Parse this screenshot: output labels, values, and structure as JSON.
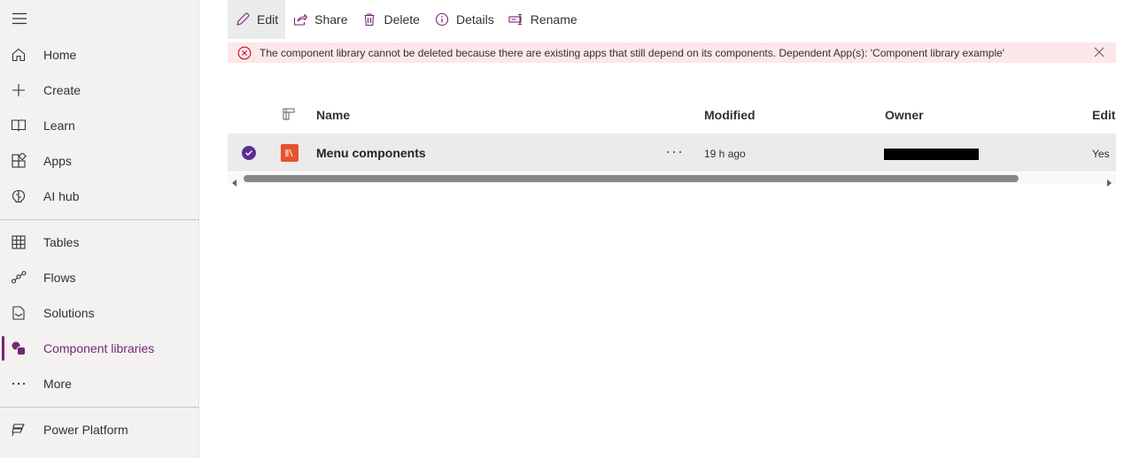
{
  "sidebar": {
    "items": [
      {
        "label": "Home",
        "icon": "home-icon"
      },
      {
        "label": "Create",
        "icon": "plus-icon"
      },
      {
        "label": "Learn",
        "icon": "book-icon"
      },
      {
        "label": "Apps",
        "icon": "apps-icon"
      },
      {
        "label": "AI hub",
        "icon": "brain-icon"
      },
      {
        "label": "Tables",
        "icon": "table-icon"
      },
      {
        "label": "Flows",
        "icon": "flow-icon"
      },
      {
        "label": "Solutions",
        "icon": "solutions-icon"
      },
      {
        "label": "Component libraries",
        "icon": "component-libraries-icon",
        "active": true
      },
      {
        "label": "More",
        "icon": "more-icon"
      },
      {
        "label": "Power Platform",
        "icon": "power-platform-icon"
      }
    ],
    "accent_color": "#742774"
  },
  "commandbar": {
    "edit": "Edit",
    "share": "Share",
    "delete": "Delete",
    "details": "Details",
    "rename": "Rename"
  },
  "banner": {
    "message": "The component library cannot be deleted because there are existing apps that still depend on its components. Dependent App(s): 'Component library example'",
    "background_color": "#fde7e9",
    "icon_color": "#c50f1f"
  },
  "table": {
    "headers": {
      "name": "Name",
      "modified": "Modified",
      "owner": "Owner",
      "editable": "Edit"
    },
    "rows": [
      {
        "name": "Menu components",
        "modified": "19 h ago",
        "owner": "",
        "editable": "Yes",
        "selected": true
      }
    ]
  }
}
